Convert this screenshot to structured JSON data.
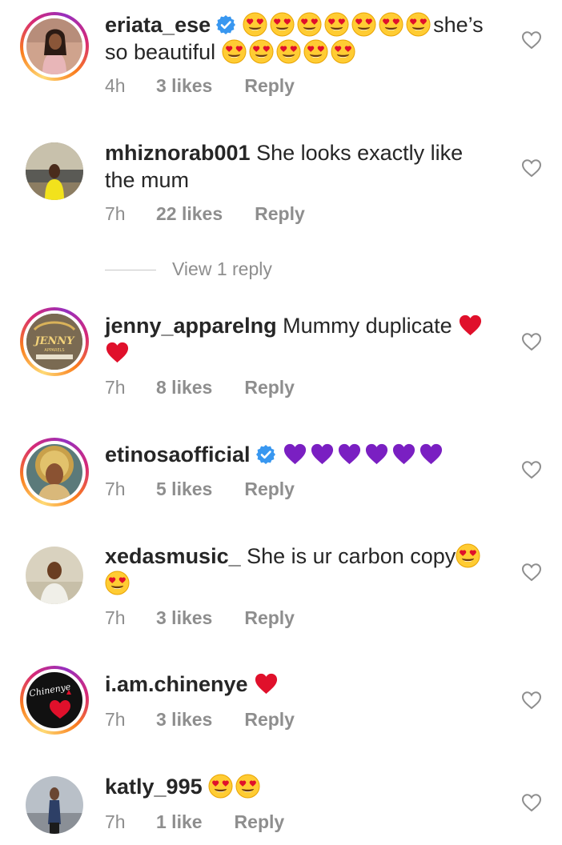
{
  "comments": [
    {
      "username": "eriata_ese",
      "verified": true,
      "emojis_before": [
        "heart-eyes",
        "heart-eyes",
        "heart-eyes",
        "heart-eyes",
        "heart-eyes",
        "heart-eyes",
        "heart-eyes"
      ],
      "text": "she’s",
      "text2": "so beautiful",
      "emojis_after": [
        "heart-eyes",
        "heart-eyes",
        "heart-eyes",
        "heart-eyes",
        "heart-eyes"
      ],
      "time": "4h",
      "likes": "3 likes",
      "reply": "Reply"
    },
    {
      "username": "mhiznorab001",
      "verified": false,
      "text": "She looks exactly like the mum",
      "time": "7h",
      "likes": "22 likes",
      "reply": "Reply"
    },
    {
      "username": "jenny_apparelng",
      "verified": false,
      "text": "Mummy duplicate",
      "emojis_after": [
        "red-heart",
        "red-heart"
      ],
      "time": "7h",
      "likes": "8 likes",
      "reply": "Reply"
    },
    {
      "username": "etinosaofficial",
      "verified": true,
      "emojis_after": [
        "purple-heart",
        "purple-heart",
        "purple-heart",
        "purple-heart",
        "purple-heart",
        "purple-heart"
      ],
      "time": "7h",
      "likes": "5 likes",
      "reply": "Reply"
    },
    {
      "username": "xedasmusic_",
      "verified": false,
      "text": "She is ur carbon copy",
      "emojis_after": [
        "heart-eyes",
        "heart-eyes"
      ],
      "time": "7h",
      "likes": "3 likes",
      "reply": "Reply"
    },
    {
      "username": "i.am.chinenye",
      "verified": false,
      "emojis_after": [
        "red-heart"
      ],
      "time": "7h",
      "likes": "3 likes",
      "reply": "Reply"
    },
    {
      "username": "katly_995",
      "verified": false,
      "emojis_after": [
        "heart-eyes",
        "heart-eyes"
      ],
      "time": "7h",
      "likes": "1 like",
      "reply": "Reply"
    }
  ],
  "view_replies": "View 1 reply",
  "avatar_text": {
    "jenny_logo_line1": "JENNY",
    "jenny_logo_line2": "APPARELS",
    "chinenye_script": "Chinenye"
  },
  "colors": {
    "text": "#262626",
    "meta": "#8e8e8e",
    "verified": "#3897f0",
    "red_heart": "#e0102b",
    "purple_heart": "#7a1fc2",
    "emoji_face": "#ffcc33"
  }
}
